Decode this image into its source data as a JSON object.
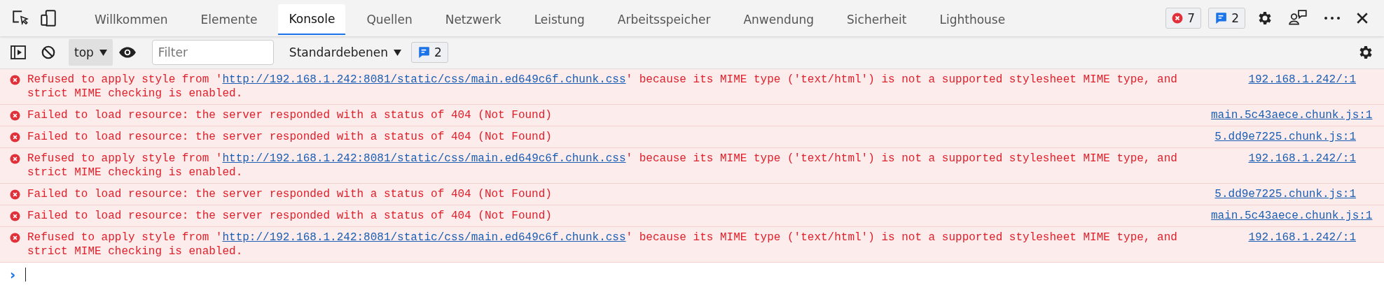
{
  "tabs": [
    {
      "label": "Willkommen",
      "selected": false
    },
    {
      "label": "Elemente",
      "selected": false
    },
    {
      "label": "Konsole",
      "selected": true
    },
    {
      "label": "Quellen",
      "selected": false
    },
    {
      "label": "Netzwerk",
      "selected": false
    },
    {
      "label": "Leistung",
      "selected": false
    },
    {
      "label": "Arbeitsspeicher",
      "selected": false
    },
    {
      "label": "Anwendung",
      "selected": false
    },
    {
      "label": "Sicherheit",
      "selected": false
    },
    {
      "label": "Lighthouse",
      "selected": false
    }
  ],
  "counters": {
    "errors": "7",
    "messages": "2"
  },
  "toolbar": {
    "context": "top",
    "filter": {
      "placeholder": "Filter"
    },
    "levels": "Standardebenen",
    "messages": "2"
  },
  "messages": [
    {
      "prefix": "Refused to apply style from '",
      "link": "http://192.168.1.242:8081/static/css/main.ed649c6f.chunk.css",
      "suffix": "' because its MIME type ('text/html') is not a supported stylesheet MIME type, and strict MIME checking is enabled.",
      "source": "192.168.1.242/:1"
    },
    {
      "prefix": "Failed to load resource: the server responded with a status of 404 (Not Found)",
      "source": "main.5c43aece.chunk.js:1"
    },
    {
      "prefix": "Failed to load resource: the server responded with a status of 404 (Not Found)",
      "source": "5.dd9e7225.chunk.js:1"
    },
    {
      "prefix": "Refused to apply style from '",
      "link": "http://192.168.1.242:8081/static/css/main.ed649c6f.chunk.css",
      "suffix": "' because its MIME type ('text/html') is not a supported stylesheet MIME type, and strict MIME checking is enabled.",
      "source": "192.168.1.242/:1"
    },
    {
      "prefix": "Failed to load resource: the server responded with a status of 404 (Not Found)",
      "source": "5.dd9e7225.chunk.js:1"
    },
    {
      "prefix": "Failed to load resource: the server responded with a status of 404 (Not Found)",
      "source": "main.5c43aece.chunk.js:1"
    },
    {
      "prefix": "Refused to apply style from '",
      "link": "http://192.168.1.242:8081/static/css/main.ed649c6f.chunk.css",
      "suffix": "' because its MIME type ('text/html') is not a supported stylesheet MIME type, and strict MIME checking is enabled.",
      "source": "192.168.1.242/:1"
    }
  ],
  "prompt": {
    "symbol": "›"
  }
}
